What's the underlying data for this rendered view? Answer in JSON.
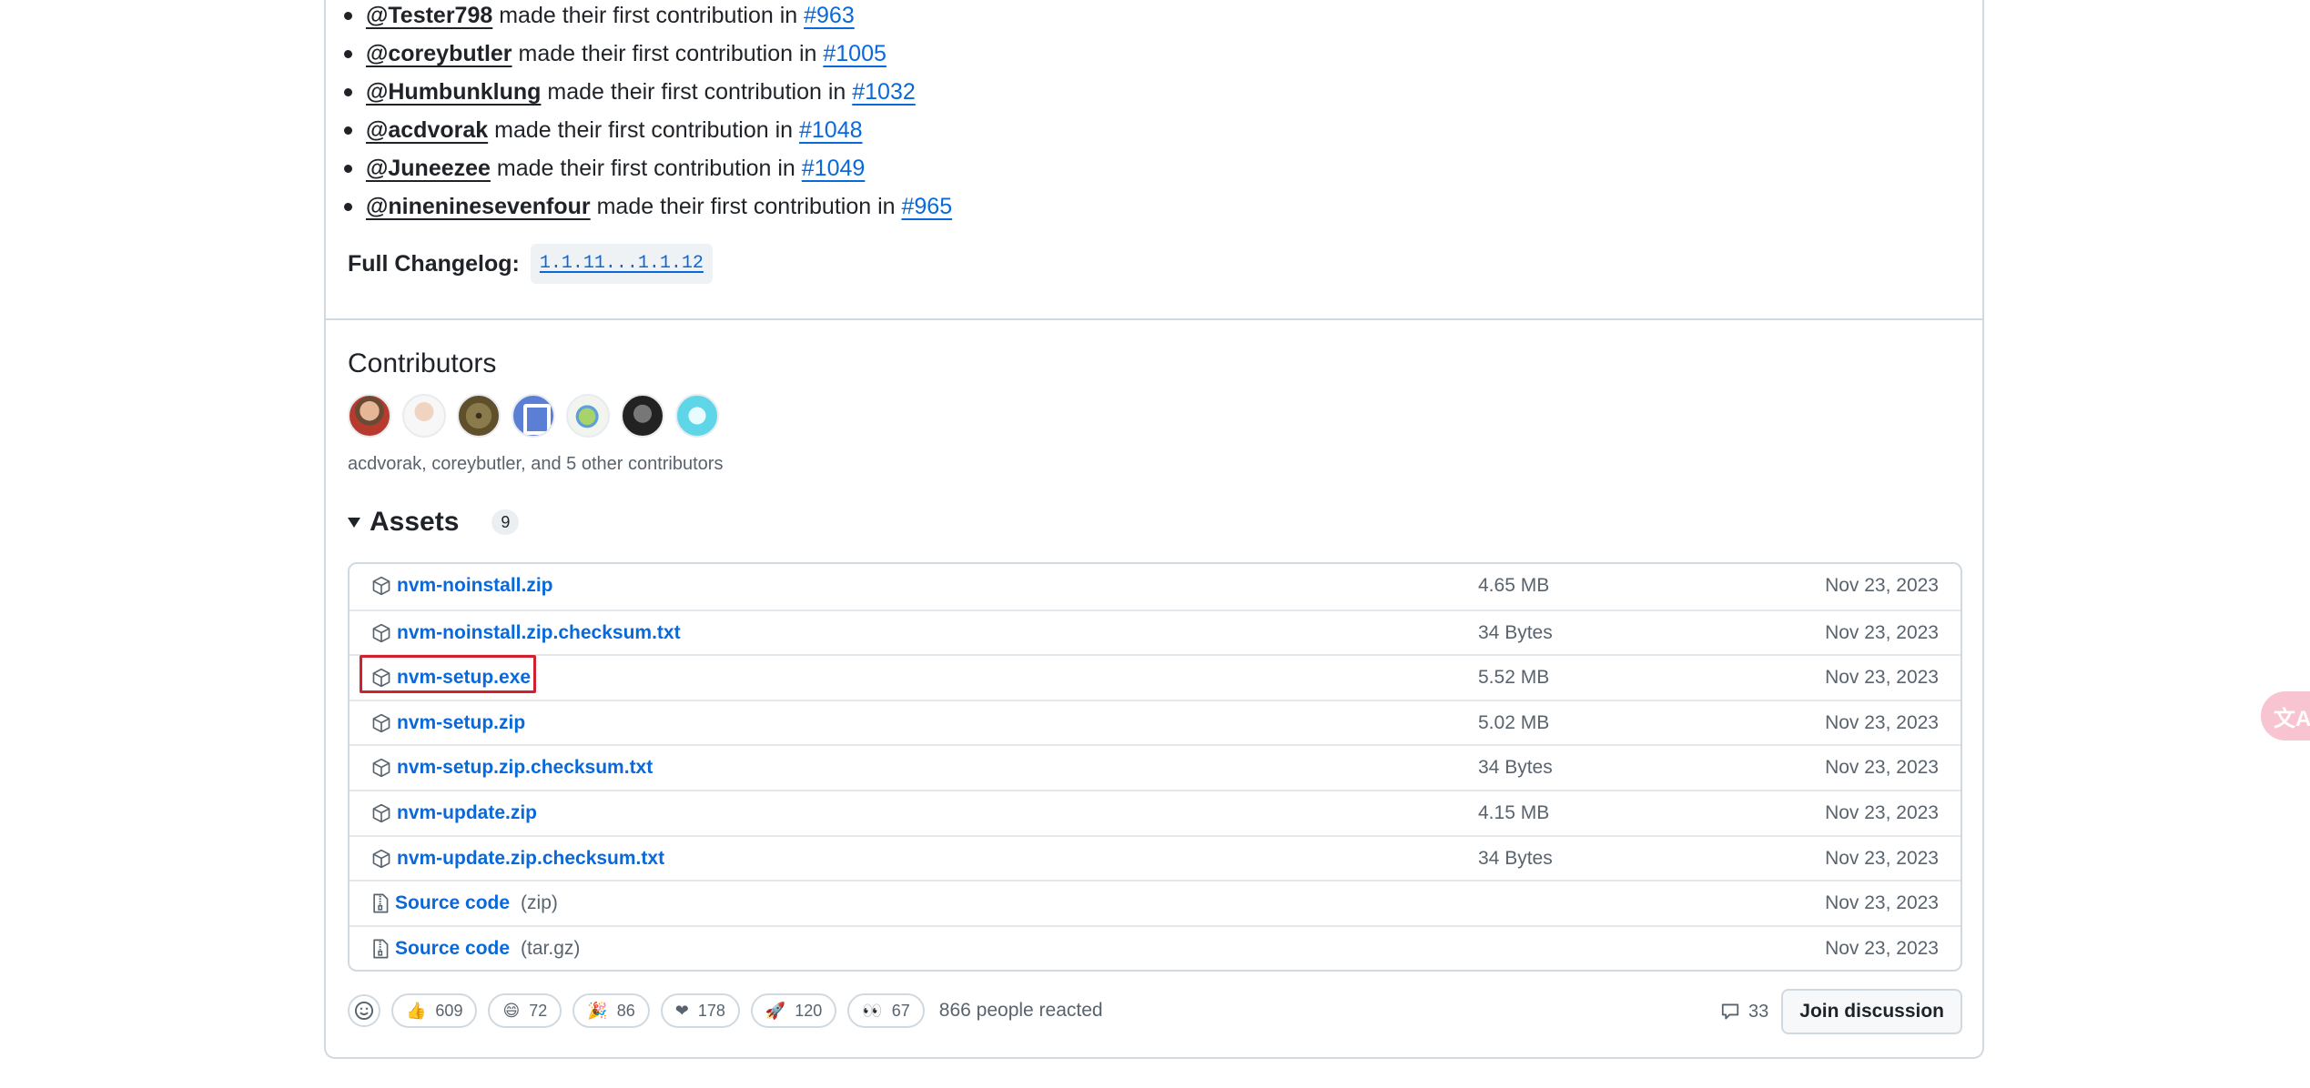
{
  "contributions": [
    {
      "user": "@Tester798",
      "text": " made their first contribution in ",
      "pr": "#963"
    },
    {
      "user": "@coreybutler",
      "text": " made their first contribution in ",
      "pr": "#1005"
    },
    {
      "user": "@Humbunklung",
      "text": " made their first contribution in ",
      "pr": "#1032"
    },
    {
      "user": "@acdvorak",
      "text": " made their first contribution in ",
      "pr": "#1048"
    },
    {
      "user": "@Juneezee",
      "text": " made their first contribution in ",
      "pr": "#1049"
    },
    {
      "user": "@nineninesevenfour",
      "text": " made their first contribution in ",
      "pr": "#965"
    }
  ],
  "full_changelog": {
    "label": "Full Changelog:",
    "compare": "1.1.11...1.1.12"
  },
  "contributors": {
    "title": "Contributors",
    "summary": "acdvorak, coreybutler, and 5 other contributors",
    "avatar_count": 7
  },
  "assets": {
    "title": "Assets",
    "count": "9",
    "rows": [
      {
        "name": "nvm-noinstall.zip",
        "suffix": "",
        "size": "4.65 MB",
        "date": "Nov 23, 2023",
        "icon": "package-icon"
      },
      {
        "name": "nvm-noinstall.zip.checksum.txt",
        "suffix": "",
        "size": "34 Bytes",
        "date": "Nov 23, 2023",
        "icon": "package-icon"
      },
      {
        "name": "nvm-setup.exe",
        "suffix": "",
        "size": "5.52 MB",
        "date": "Nov 23, 2023",
        "icon": "package-icon"
      },
      {
        "name": "nvm-setup.zip",
        "suffix": "",
        "size": "5.02 MB",
        "date": "Nov 23, 2023",
        "icon": "package-icon"
      },
      {
        "name": "nvm-setup.zip.checksum.txt",
        "suffix": "",
        "size": "34 Bytes",
        "date": "Nov 23, 2023",
        "icon": "package-icon"
      },
      {
        "name": "nvm-update.zip",
        "suffix": "",
        "size": "4.15 MB",
        "date": "Nov 23, 2023",
        "icon": "package-icon"
      },
      {
        "name": "nvm-update.zip.checksum.txt",
        "suffix": "",
        "size": "34 Bytes",
        "date": "Nov 23, 2023",
        "icon": "package-icon"
      },
      {
        "name": "Source code",
        "suffix": "(zip)",
        "size": "",
        "date": "Nov 23, 2023",
        "icon": "file-zip-icon"
      },
      {
        "name": "Source code",
        "suffix": "(tar.gz)",
        "size": "",
        "date": "Nov 23, 2023",
        "icon": "file-zip-icon"
      }
    ]
  },
  "reactions": {
    "items": [
      {
        "emoji": "👍",
        "icon": "thumbs-up-icon",
        "count": "609"
      },
      {
        "emoji": "😄",
        "icon": "laugh-icon",
        "count": "72"
      },
      {
        "emoji": "🎉",
        "icon": "hooray-icon",
        "count": "86"
      },
      {
        "emoji": "❤",
        "icon": "heart-icon",
        "count": "178"
      },
      {
        "emoji": "🚀",
        "icon": "rocket-icon",
        "count": "120"
      },
      {
        "emoji": "👀",
        "icon": "eyes-icon",
        "count": "67"
      }
    ],
    "summary": "866 people reacted"
  },
  "discussion": {
    "comment_count": "33",
    "join_label": "Join discussion"
  },
  "translate_widget": {
    "icon": "translate-icon",
    "glyph": "文A"
  },
  "colors": {
    "link": "#0969da",
    "highlight": "#cf222e"
  }
}
